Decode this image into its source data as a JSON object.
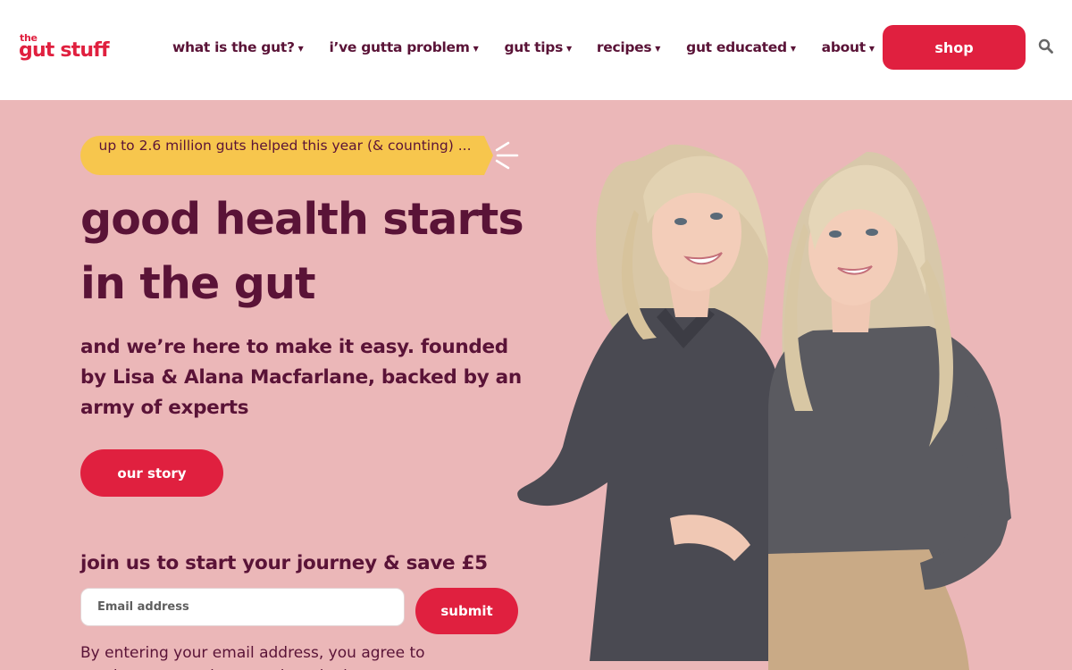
{
  "brand": {
    "logo_top": "the",
    "logo_main": "gut stuff",
    "primary_color": "#e0203f",
    "accent_color": "#f7c64d",
    "text_color": "#5a1337",
    "background_color": "#ebb7b8"
  },
  "nav": {
    "items": [
      {
        "label": "what is the gut?"
      },
      {
        "label": "i’ve gutta problem"
      },
      {
        "label": "gut tips"
      },
      {
        "label": "recipes"
      },
      {
        "label": "gut educated"
      },
      {
        "label": "about"
      }
    ],
    "shop_label": "shop",
    "search_icon": "search-icon"
  },
  "hero": {
    "badge": "up to 2.6 million guts helped this year (& counting) ...",
    "headline_line1": "good health starts",
    "headline_line2": "in the gut",
    "subtext": "and we’re here to make it easy. founded by Lisa & Alana Macfarlane, backed by an army of experts",
    "story_button": "our story"
  },
  "signup": {
    "heading": "join us to start your journey & save £5",
    "email_placeholder": "Email address",
    "email_value": "",
    "submit_label": "submit",
    "legal": "By entering your email address, you agree to receive our newsletter and marketing"
  }
}
